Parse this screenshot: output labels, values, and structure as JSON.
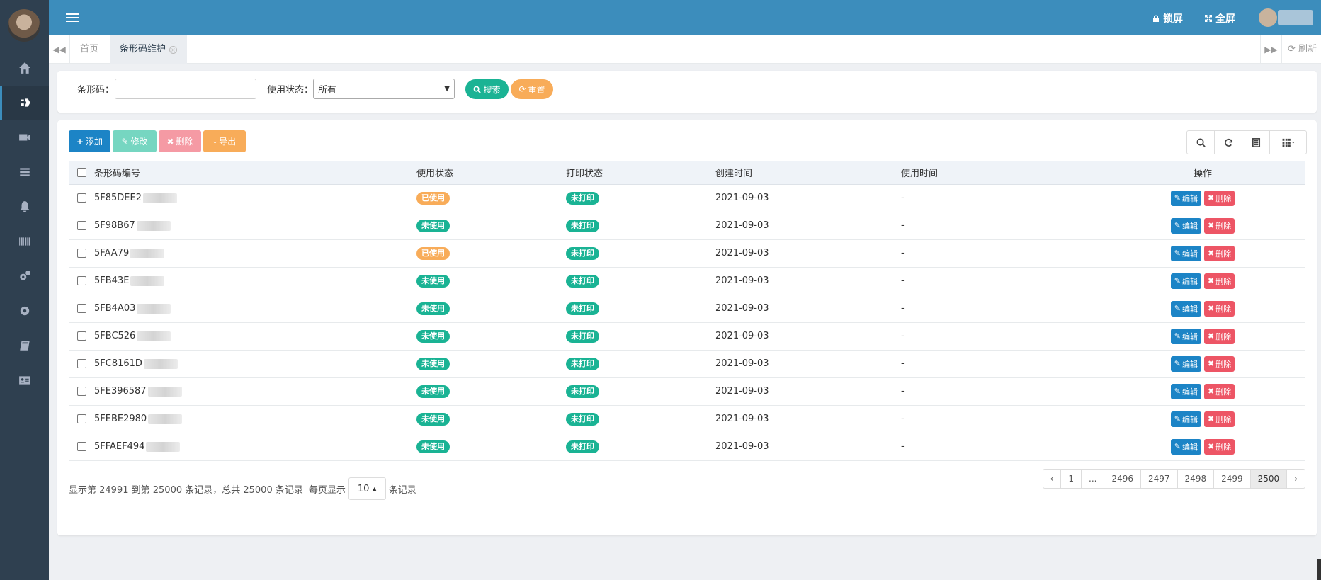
{
  "header": {
    "lock_label": "锁屏",
    "fullscreen_label": "全屏"
  },
  "tabs": [
    {
      "label": "首页"
    },
    {
      "label": "条形码维护"
    }
  ],
  "tabbar": {
    "refresh_label": "刷新"
  },
  "search": {
    "barcode_label": "条形码：",
    "barcode_value": "",
    "status_label": "使用状态：",
    "status_selected": "所有",
    "search_button": "搜索",
    "reset_button": "重置"
  },
  "toolbar": {
    "add": "添加",
    "edit": "修改",
    "delete": "删除",
    "export": "导出"
  },
  "table": {
    "columns": [
      "条形码编号",
      "使用状态",
      "打印状态",
      "创建时间",
      "使用时间",
      "操作"
    ],
    "rows": [
      {
        "code": "5F85DEE2",
        "status": "已使用",
        "print": "未打印",
        "created": "2021-09-03",
        "used": "-"
      },
      {
        "code": "5F98B67",
        "status": "未使用",
        "print": "未打印",
        "created": "2021-09-03",
        "used": "-"
      },
      {
        "code": "5FAA79",
        "status": "已使用",
        "print": "未打印",
        "created": "2021-09-03",
        "used": "-"
      },
      {
        "code": "5FB43E",
        "status": "未使用",
        "print": "未打印",
        "created": "2021-09-03",
        "used": "-"
      },
      {
        "code": "5FB4A03",
        "status": "未使用",
        "print": "未打印",
        "created": "2021-09-03",
        "used": "-"
      },
      {
        "code": "5FBC526",
        "status": "未使用",
        "print": "未打印",
        "created": "2021-09-03",
        "used": "-"
      },
      {
        "code": "5FC8161D",
        "status": "未使用",
        "print": "未打印",
        "created": "2021-09-03",
        "used": "-"
      },
      {
        "code": "5FE396587",
        "status": "未使用",
        "print": "未打印",
        "created": "2021-09-03",
        "used": "-"
      },
      {
        "code": "5FEBE2980",
        "status": "未使用",
        "print": "未打印",
        "created": "2021-09-03",
        "used": "-"
      },
      {
        "code": "5FFAEF494",
        "status": "未使用",
        "print": "未打印",
        "created": "2021-09-03",
        "used": "-"
      }
    ],
    "row_edit_label": "编辑",
    "row_delete_label": "删除"
  },
  "footer": {
    "summary": "显示第 24991 到第 25000 条记录，总共 25000 条记录",
    "per_page_prefix": "每页显示",
    "per_page_value": "10",
    "per_page_suffix": "条记录"
  },
  "pagination": {
    "prev": "‹",
    "pages": [
      "1",
      "...",
      "2496",
      "2497",
      "2498",
      "2499",
      "2500"
    ],
    "active": "2500",
    "next": "›"
  },
  "colors": {
    "sidebar": "#2f4050",
    "header": "#3c8dbc",
    "green": "#1ab394",
    "orange": "#f8ac59",
    "blue": "#1c84c6",
    "red": "#ed5565"
  }
}
